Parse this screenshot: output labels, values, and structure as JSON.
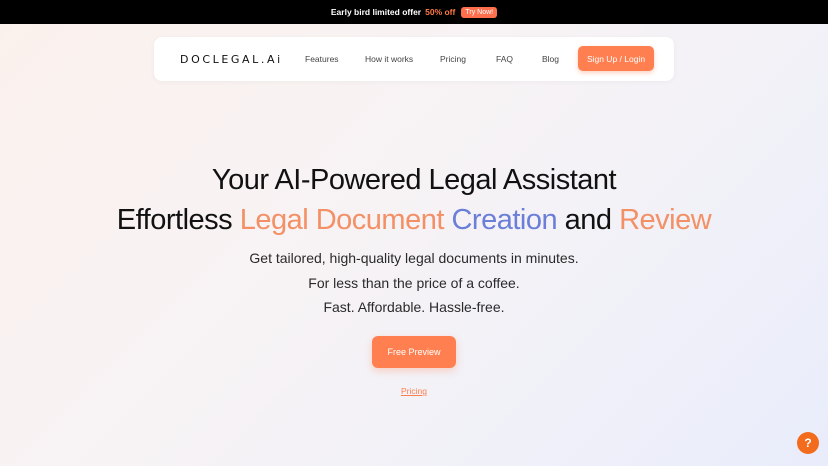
{
  "banner": {
    "text": "Early bird limited offer",
    "discount": "50% off",
    "cta": "Try Now!"
  },
  "nav": {
    "logo": "DOCLEGAL.Ai",
    "links": [
      "Features",
      "How it works",
      "Pricing",
      "FAQ",
      "Blog"
    ],
    "signup": "Sign Up / Login"
  },
  "hero": {
    "line1": "Your AI-Powered Legal Assistant",
    "line2_part1": "Effortless",
    "line2_part2": "Legal Document",
    "line2_part3": "Creation",
    "line2_part4": "and",
    "line2_part5": "Review",
    "sub1": "Get tailored, high-quality legal documents in minutes.",
    "sub2": "For less than the price of a coffee.",
    "sub3": "Fast. Affordable. Hassle-free.",
    "cta": "Free Preview",
    "pricing_link": "Pricing"
  },
  "help": {
    "icon": "question-icon",
    "label": "?"
  },
  "colors": {
    "accent": "#ff7f50",
    "help": "#f36b1c",
    "blue": "#6b7ed8"
  }
}
